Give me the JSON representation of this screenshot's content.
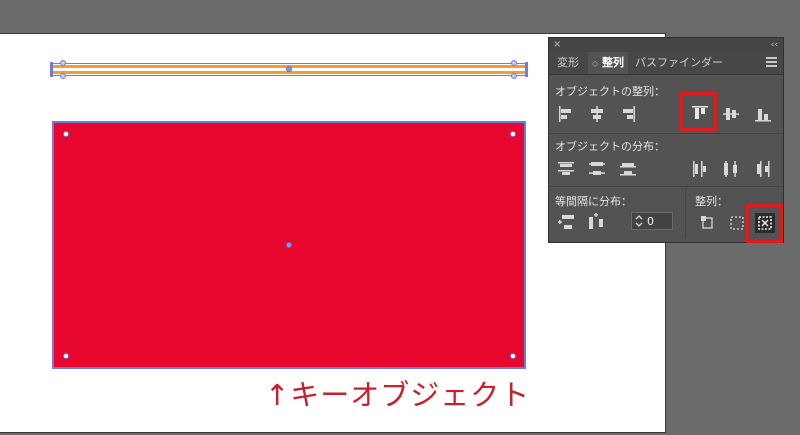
{
  "panel": {
    "close_glyph": "×",
    "collapse_glyph": "‹‹",
    "tabs": [
      {
        "label": "変形",
        "active": false
      },
      {
        "label": "整列",
        "active": true
      },
      {
        "label": "パスファインダー",
        "active": false
      }
    ],
    "tab_sort_glyph": "◇",
    "align_objects_label": "オブジェクトの整列：",
    "distribute_objects_label": "オブジェクトの分布：",
    "distribute_spacing_label": "等間隔に分布：",
    "align_to_label": "整列：",
    "spacing_value": "0",
    "highlighted_buttons": [
      "vertical-align-top-button",
      "align-to-key-object-button"
    ]
  },
  "colors": {
    "canvas_bg": "#6b6b6b",
    "artboard": "#ffffff",
    "red_rect": "#e8072e",
    "orange_bar": "#f0a032",
    "selection": "#6c7ce0",
    "highlight_box": "#e01b1b",
    "caption": "#c8202a"
  },
  "caption": "↑キーオブジェクト"
}
